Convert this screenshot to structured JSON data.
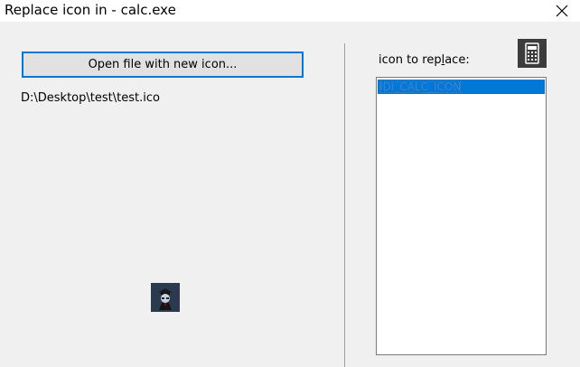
{
  "window": {
    "title": "Replace icon in - calc.exe",
    "close_icon": "close-icon"
  },
  "left_panel": {
    "open_button_label": "Open file with new icon...",
    "file_path": "D:\\Desktop\\test\\test.ico",
    "preview_icon": "new-icon-preview"
  },
  "right_panel": {
    "label_before": "icon to rep",
    "label_mnemonic": "l",
    "label_after": "ace:",
    "current_icon": "calculator-icon",
    "list_items": [
      "IDI_CALC_ICON"
    ],
    "selected_index": 0
  },
  "colors": {
    "accent": "#0078d7",
    "background": "#f0f0f0",
    "selection_text": "#4a80b8"
  }
}
